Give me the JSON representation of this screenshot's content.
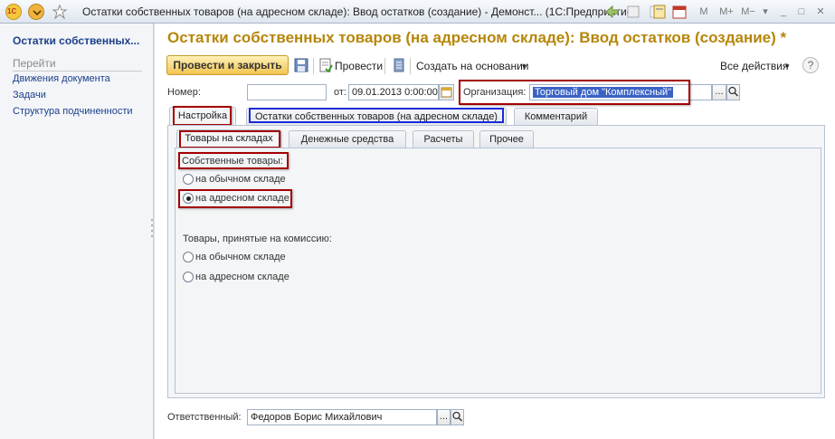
{
  "window": {
    "title": "Остатки собственных товаров (на адресном складе): Ввод остатков (создание) - Демонст...  (1С:Предприятие)",
    "logo_text": "1С"
  },
  "sidebar": {
    "title": "Остатки собственных...",
    "go_label": "Перейти",
    "items": [
      {
        "label": "Движения документа"
      },
      {
        "label": "Задачи"
      },
      {
        "label": "Структура подчиненности"
      }
    ]
  },
  "header": {
    "title": "Остатки собственных товаров (на адресном складе): Ввод остатков (создание) *"
  },
  "toolbar": {
    "post_close_label": "Провести и закрыть",
    "post_label": "Провести",
    "create_based_label": "Создать на основании",
    "all_actions_label": "Все действия",
    "help_label": "?"
  },
  "fields": {
    "number_label": "Номер:",
    "number_value": "",
    "date_label": "от:",
    "date_value": "09.01.2013  0:00:00",
    "org_label": "Организация:",
    "org_value": "Торговый дом \"Комплексный\"",
    "responsible_label": "Ответственный:",
    "responsible_value": "Федоров Борис Михайлович",
    "choose_label": "..."
  },
  "tabs": [
    {
      "label": "Настройка"
    },
    {
      "label": "Остатки собственных товаров (на адресном складе)"
    },
    {
      "label": "Комментарий"
    }
  ],
  "subtabs": [
    {
      "label": "Товары на складах"
    },
    {
      "label": "Денежные средства"
    },
    {
      "label": "Расчеты"
    },
    {
      "label": "Прочее"
    }
  ],
  "own_goods": {
    "label": "Собственные товары:",
    "option_regular": "на обычном складе",
    "option_address": "на адресном складе",
    "selected": "на адресном складе"
  },
  "commission_goods": {
    "label": "Товары, принятые на комиссию:",
    "option_regular": "на обычном складе",
    "option_address": "на адресном складе",
    "selected": ""
  },
  "colors": {
    "accent": "#b6860a",
    "link": "#1c3f8a",
    "highlight": "#a40000",
    "blue_highlight": "#1a2bd8",
    "selection": "#3b63c4"
  },
  "icons": [
    "logo-icon",
    "menu-icon",
    "favorite-icon",
    "back-icon",
    "calculator-icon",
    "calendar-icon",
    "save-icon",
    "post-icon",
    "list-icon",
    "search-icon",
    "calendar-picker-icon",
    "dropdown-icon"
  ]
}
